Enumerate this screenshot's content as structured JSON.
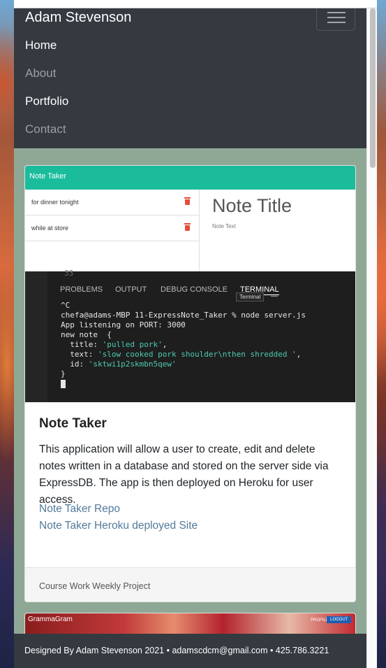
{
  "navbar": {
    "brand": "Adam Stevenson",
    "links": [
      {
        "label": "Home",
        "state": "active"
      },
      {
        "label": "About",
        "state": "muted"
      },
      {
        "label": "Portfolio",
        "state": "active"
      },
      {
        "label": "Contact",
        "state": "muted"
      }
    ],
    "toggler_icon": "hamburger-icon"
  },
  "project_card": {
    "screenshot": {
      "app_header": "Note Taker",
      "notes": [
        "for dinner tonight",
        "while at store"
      ],
      "note_title_placeholder": "Note Title",
      "note_text_placeholder": "Note Text",
      "terminal": {
        "line_number": "33",
        "tabs": [
          "PROBLEMS",
          "OUTPUT",
          "DEBUG CONSOLE",
          "TERMINAL"
        ],
        "tooltip": "Terminal",
        "lines": [
          "^C",
          "chefa@adams-MBP 11-ExpressNote_Taker % node server.js",
          "App listening on PORT: 3000",
          "new note  {",
          "  title: ",
          "  text: ",
          "  id: ",
          "}"
        ],
        "title_value": "'pulled pork'",
        "text_value": "'slow cooked pork shoulder\\nthen shredded '",
        "id_value": "'sktwi1p2skmbn5qew'"
      }
    },
    "title": "Note Taker",
    "description": "This application will allow a user to create, edit and delete notes written in a database and stored on the server side via ExpressDB. The app is then deployed on Heroku for user access.",
    "links": [
      "Note Taker Repo",
      "Note Taker Heroku deployed Site"
    ],
    "footer": "Course Work Weekly Project"
  },
  "next_card": {
    "label": "GrammaGram",
    "profile": "PROFILE",
    "logout": "LOGOUT"
  },
  "footer": {
    "text": "Designed By Adam Stevenson 2021 • adamscdcm@gmail.com • 425.786.3221"
  },
  "colors": {
    "navbar_bg": "#343a40",
    "content_bg": "#8fa895",
    "app_header": "#1abc9c",
    "link": "#527a9a",
    "trash": "#e74c3c"
  }
}
